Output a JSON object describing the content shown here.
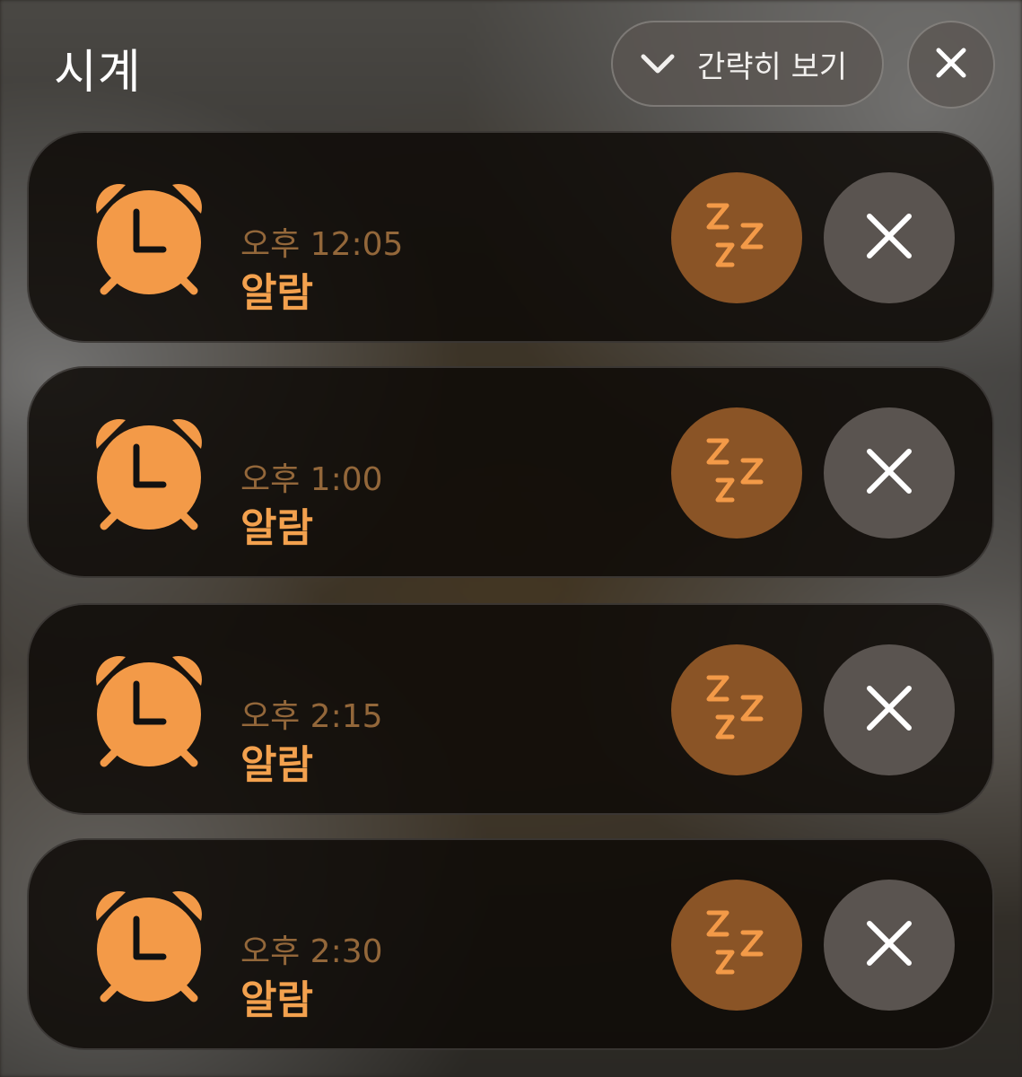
{
  "header": {
    "title": "시계",
    "collapse_label": "간략히 보기"
  },
  "alarms": [
    {
      "time": "오후 12:05",
      "label": "알람"
    },
    {
      "time": "오후 1:00",
      "label": "알람"
    },
    {
      "time": "오후 2:15",
      "label": "알람"
    },
    {
      "time": "오후 2:30",
      "label": "알람"
    }
  ],
  "icons": {
    "collapse": "chevron-down-icon",
    "close_all": "close-icon",
    "alarm": "alarm-clock-icon",
    "snooze": "snooze-zzz-icon",
    "dismiss": "close-icon"
  },
  "colors": {
    "accent_orange": "#f39a48",
    "time_text": "#93673a",
    "snooze_bg": "#8a5426",
    "dismiss_bg": "#5a5450"
  }
}
